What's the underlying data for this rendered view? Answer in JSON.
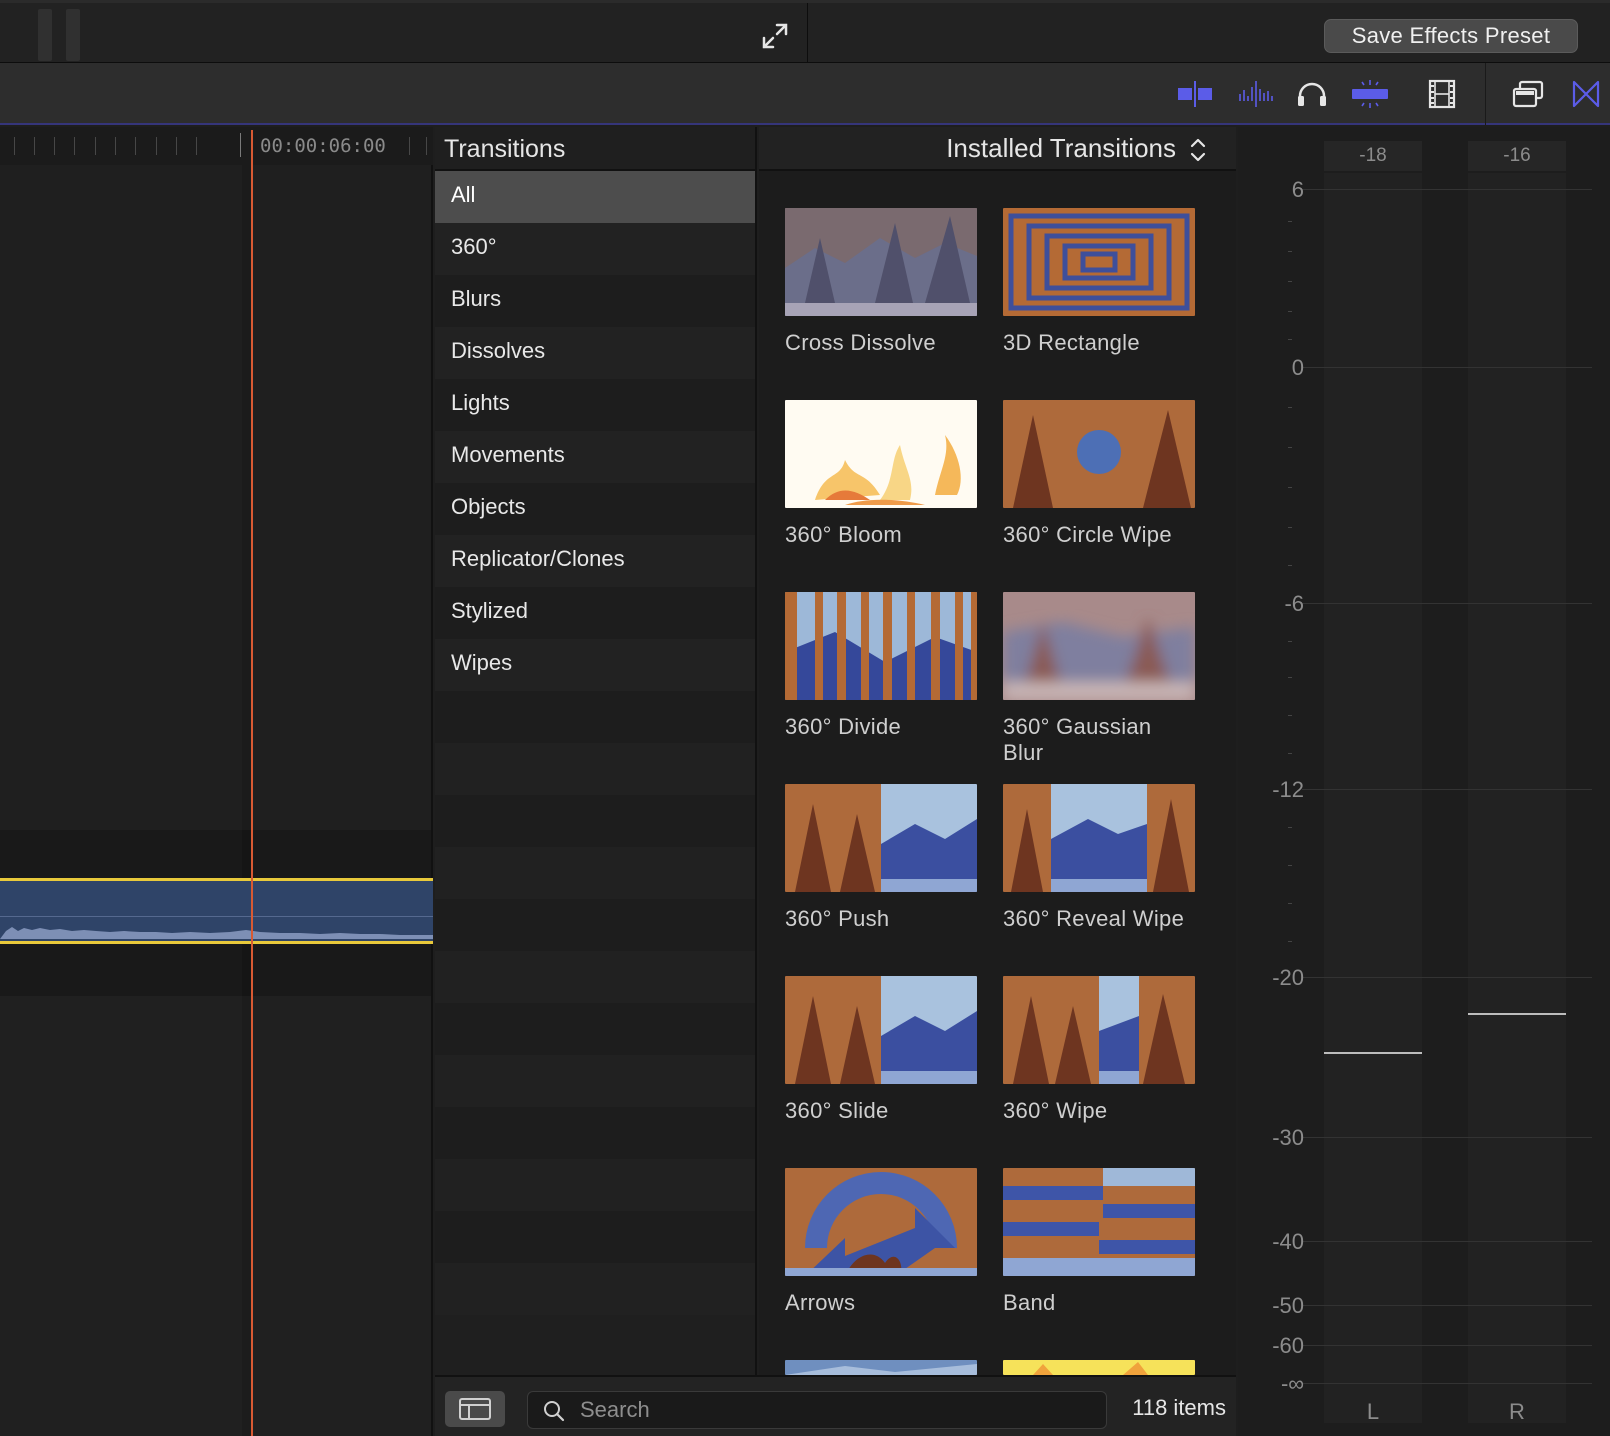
{
  "header": {
    "save_preset_label": "Save Effects Preset"
  },
  "toolbar": {
    "icons": [
      "clip-skimming-icon",
      "audio-skimming-icon",
      "headphones-icon",
      "snapping-icon",
      "filmstrip-icon",
      "clip-appearance-icon",
      "transitions-browser-icon"
    ],
    "accent": "#5b5ce8"
  },
  "timeline": {
    "timecode": "00:00:06:00",
    "playhead_color": "#d85a33",
    "clip_border_color": "#e8c93b"
  },
  "sidebar": {
    "title": "Transitions",
    "categories": [
      "All",
      "360°",
      "Blurs",
      "Dissolves",
      "Lights",
      "Movements",
      "Objects",
      "Replicator/Clones",
      "Stylized",
      "Wipes"
    ],
    "selected": "All"
  },
  "browser": {
    "collection": "Installed Transitions",
    "items": [
      {
        "label": "Cross Dissolve",
        "thumb": "cross-dissolve"
      },
      {
        "label": "3D Rectangle",
        "thumb": "3d-rectangle"
      },
      {
        "label": "360° Bloom",
        "thumb": "bloom"
      },
      {
        "label": "360° Circle Wipe",
        "thumb": "circle-wipe"
      },
      {
        "label": "360° Divide",
        "thumb": "divide"
      },
      {
        "label": "360° Gaussian Blur",
        "thumb": "gaussian-blur"
      },
      {
        "label": "360° Push",
        "thumb": "push"
      },
      {
        "label": "360° Reveal Wipe",
        "thumb": "reveal-wipe"
      },
      {
        "label": "360° Slide",
        "thumb": "slide"
      },
      {
        "label": "360° Wipe",
        "thumb": "wipe"
      },
      {
        "label": "Arrows",
        "thumb": "arrows"
      },
      {
        "label": "Band",
        "thumb": "band"
      }
    ]
  },
  "footer": {
    "search_placeholder": "Search",
    "item_count": "118 items"
  },
  "meters": {
    "peaks": [
      "-18",
      "-16"
    ],
    "scale": [
      "6",
      "0",
      "-6",
      "-12",
      "-20",
      "-30",
      "-40",
      "-50",
      "-60",
      "-∞"
    ],
    "channels": [
      "L",
      "R"
    ]
  }
}
